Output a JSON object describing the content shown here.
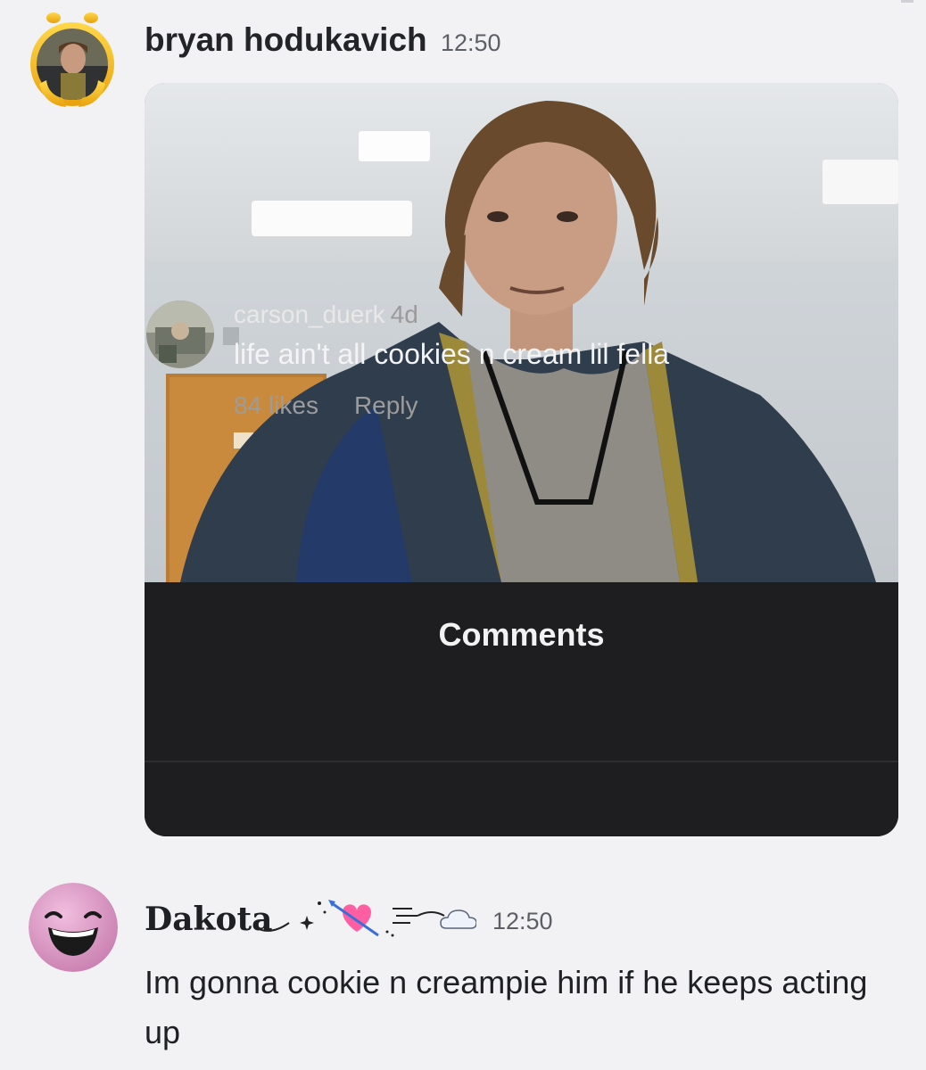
{
  "messages": [
    {
      "author": "bryan hodukavich",
      "time": "12:50",
      "embed": {
        "panel_title": "Comments",
        "comment": {
          "user": "carson_duerk",
          "age": "4d",
          "text": "life ain't all cookies n cream lil fella",
          "likes": "84 likes",
          "reply_label": "Reply"
        }
      }
    },
    {
      "author": "Dakota",
      "decorations": [
        "sparkle-icon",
        "heart-with-arrow-icon",
        "wind-icon",
        "cloud-icon"
      ],
      "time": "12:50",
      "text": "Im gonna cookie n creampie him if he keeps acting up"
    }
  ],
  "colors": {
    "background": "#f2f2f4",
    "comments_panel": "#1e1e20",
    "heart": "#ff5fa2",
    "avatar_pink": "#e9a6cf"
  }
}
